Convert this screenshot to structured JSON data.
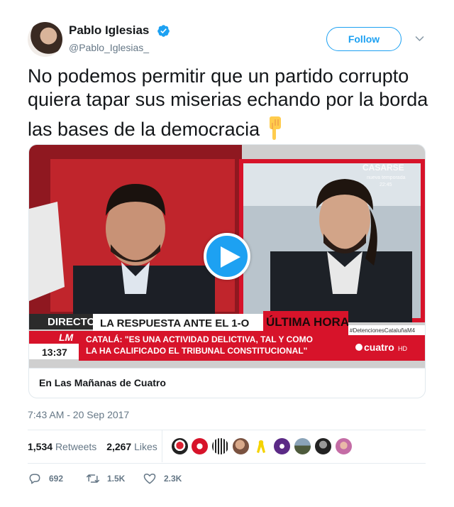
{
  "author": {
    "name": "Pablo Iglesias",
    "handle": "@Pablo_Iglesias_",
    "verified": true
  },
  "follow_label": "Follow",
  "tweet_text": "No podemos permitir que un partido corrupto quiera tapar sus miserias echando por la borda las bases de la democracia",
  "tweet_emoji": "backhand-index-pointing-down",
  "card": {
    "title": "En Las Mañanas de Cuatro",
    "video": {
      "directo": "DIRECTO",
      "headline": "LA RESPUESTA ANTE EL 1-O",
      "ultima_hora": "ÚLTIMA HORA",
      "quote_line1": "CATALÁ: \"ES UNA ACTIVIDAD DELICTIVA, TAL Y COMO",
      "quote_line2": "LA HA CALIFICADO EL TRIBUNAL CONSTITUCIONAL\"",
      "clock": "13:37",
      "hashtag": "#DetencionesCataluñaM4",
      "channel": "cuatro",
      "channel_suffix": "HD",
      "corner_text": "CASARSE",
      "corner_sub": "nueva temporada",
      "corner_time": "22:45"
    }
  },
  "timestamp": "7:43 AM - 20 Sep 2017",
  "stats": {
    "retweets_count": "1,534",
    "retweets_label": "Retweets",
    "likes_count": "2,267",
    "likes_label": "Likes"
  },
  "actions": {
    "reply_count": "692",
    "retweet_count": "1.5K",
    "like_count": "2.3K"
  },
  "colors": {
    "twitter_blue": "#1da1f2",
    "text_dark": "#14171a",
    "text_gray": "#657786",
    "tv_red": "#d7132a"
  }
}
